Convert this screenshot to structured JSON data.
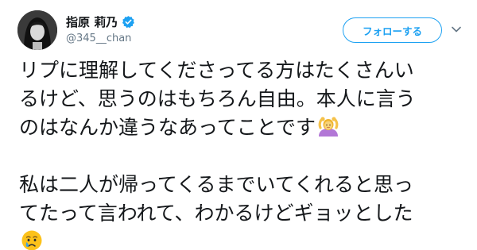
{
  "user": {
    "display_name": "指原 莉乃",
    "handle": "@345__chan",
    "verified": true
  },
  "header": {
    "follow_label": "フォローする",
    "menu_icon": "chevron-down-icon"
  },
  "colors": {
    "accent": "#1da1f2",
    "text": "#14171a",
    "secondary_text": "#657786"
  },
  "tweet": {
    "lines": [
      "リプに理解してくださってる方はたくさんい",
      "るけど、思うのはもちろん自由。本人に言う",
      "のはなんか違うなあってことです",
      "私は二人が帰ってくるまでいてくれると思っ",
      "てたって言われて、わかるけどギョッとした"
    ],
    "emojis": [
      "person-gesturing-ok-icon",
      "crying-face-icon"
    ]
  }
}
